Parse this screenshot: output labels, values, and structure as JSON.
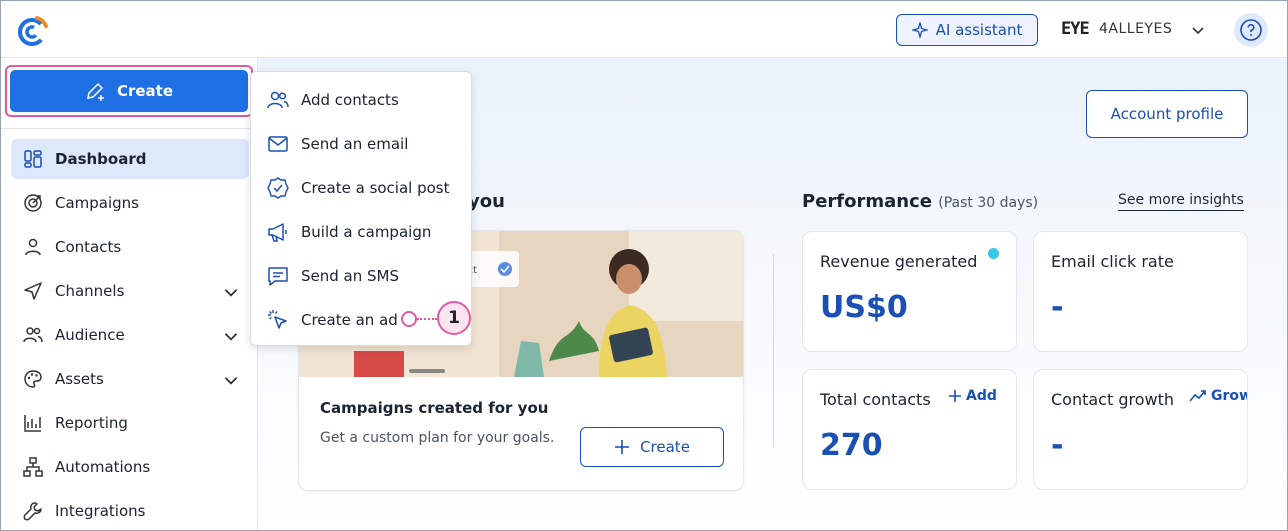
{
  "topbar": {
    "ai_assistant_label": "AI assistant",
    "account_logo_text": "EYE",
    "account_name": "4ALLEYES"
  },
  "sidebar": {
    "create_label": "Create",
    "items": [
      {
        "label": "Dashboard",
        "icon": "dashboard-icon",
        "active": true
      },
      {
        "label": "Campaigns",
        "icon": "target-icon"
      },
      {
        "label": "Contacts",
        "icon": "person-icon"
      },
      {
        "label": "Channels",
        "icon": "send-icon",
        "expandable": true
      },
      {
        "label": "Audience",
        "icon": "people-icon",
        "expandable": true
      },
      {
        "label": "Assets",
        "icon": "palette-icon",
        "expandable": true
      },
      {
        "label": "Reporting",
        "icon": "chart-icon"
      },
      {
        "label": "Automations",
        "icon": "flow-icon"
      },
      {
        "label": "Integrations",
        "icon": "wrench-icon"
      }
    ]
  },
  "create_menu": {
    "items": [
      {
        "label": "Add contacts",
        "icon": "add-contacts-icon"
      },
      {
        "label": "Send an email",
        "icon": "envelope-icon"
      },
      {
        "label": "Create a social post",
        "icon": "social-badge-icon"
      },
      {
        "label": "Build a campaign",
        "icon": "megaphone-icon"
      },
      {
        "label": "Send an SMS",
        "icon": "sms-icon"
      },
      {
        "label": "Create an ad",
        "icon": "cursor-click-icon"
      }
    ]
  },
  "callout": {
    "number": "1"
  },
  "main": {
    "account_profile_label": "Account profile",
    "section_for_you_tail": "you",
    "promo": {
      "image_tag_text": "duct",
      "title": "Campaigns created for you",
      "subtitle": "Get a custom plan for your goals.",
      "create_label": "Create"
    },
    "performance": {
      "title": "Performance",
      "period": "(Past 30 days)",
      "see_more": "See more insights",
      "metrics": {
        "revenue": {
          "label": "Revenue generated",
          "value": "US$0"
        },
        "click_rate": {
          "label": "Email click rate",
          "value": "-"
        },
        "total_contacts": {
          "label": "Total contacts",
          "value": "270",
          "action": "Add"
        },
        "contact_growth": {
          "label": "Contact growth",
          "value": "-",
          "action": "Grow"
        }
      }
    }
  },
  "colors": {
    "brand_blue": "#1f6fe5",
    "link_blue": "#1a4fb6",
    "highlight_pink": "#e05aa5"
  }
}
